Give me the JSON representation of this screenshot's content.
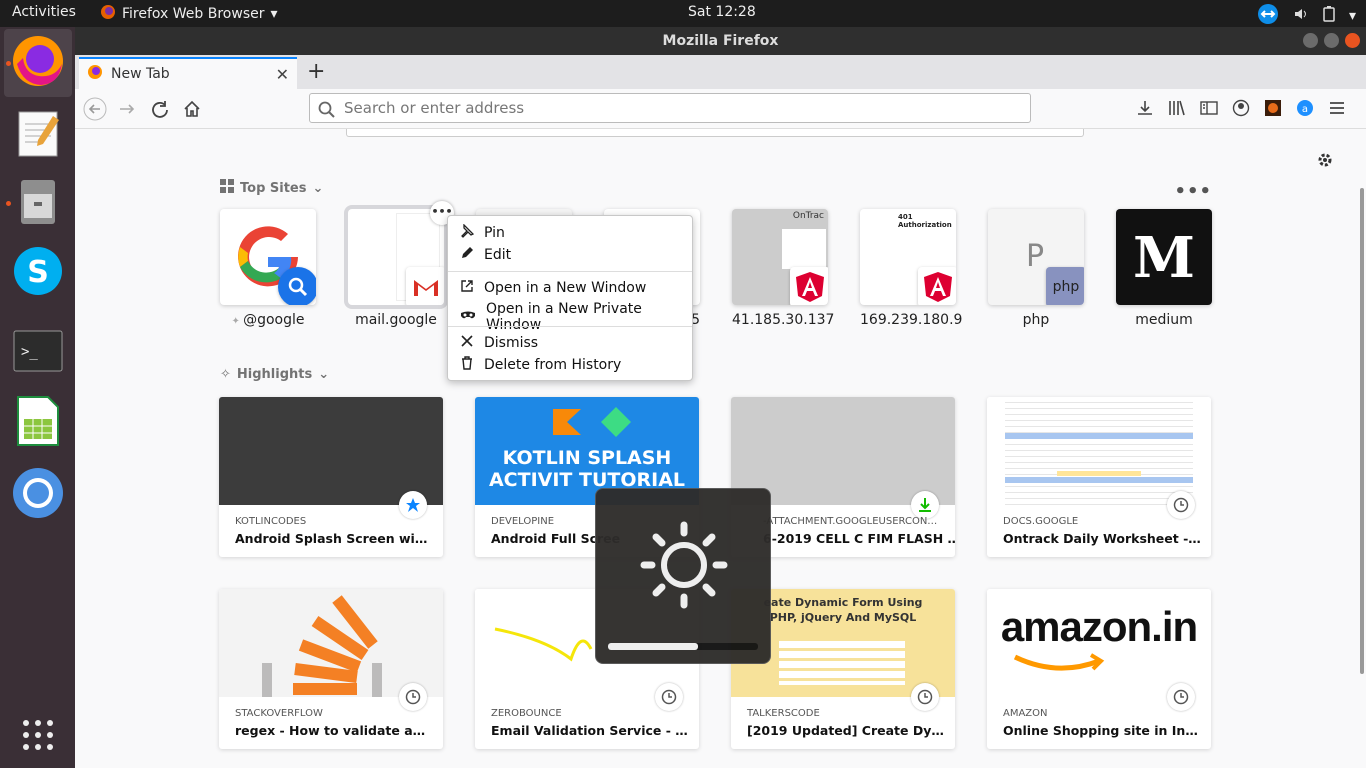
{
  "topbar": {
    "activities": "Activities",
    "app_menu": "Firefox Web Browser",
    "clock": "Sat 12:28"
  },
  "window": {
    "title": "Mozilla Firefox"
  },
  "tab": {
    "label": "New Tab"
  },
  "urlbar": {
    "placeholder": "Search or enter address"
  },
  "sections": {
    "top_sites": "Top Sites",
    "highlights": "Highlights"
  },
  "top_sites": [
    {
      "label": "@google"
    },
    {
      "label": "mail.google"
    },
    {
      "label": "5"
    },
    {
      "label": "41.185.30.137",
      "thumb_text": "OnTrac"
    },
    {
      "label": "169.239.180.9",
      "thumb_text": "401 Authorization"
    },
    {
      "label": "php",
      "thumb_text": "P"
    },
    {
      "label": "medium",
      "thumb_text": "M"
    }
  ],
  "context_menu": {
    "pin": "Pin",
    "edit": "Edit",
    "open_new_window": "Open in a New Window",
    "open_private_window": "Open in a New Private Window",
    "dismiss": "Dismiss",
    "delete_history": "Delete from History"
  },
  "highlights": [
    {
      "source": "KOTLINCODES",
      "title": "Android Splash Screen with Kot…"
    },
    {
      "source": "DEVELOPINE",
      "title": "Android Full Scree",
      "image_text": "KOTLIN SPLASH ACTIVIT TUTORIAL"
    },
    {
      "source": "-ATTACHMENT.GOOGLEUSERCON…",
      "title": "6-2019 CELL C FIM FLASH …"
    },
    {
      "source": "DOCS.GOOGLE",
      "title": "Ontrack Daily Worksheet - Goo…"
    },
    {
      "source": "STACKOVERFLOW",
      "title": "regex - How to validate an emai…"
    },
    {
      "source": "ZEROBOUNCE",
      "title": "Email Validation Service - Email…"
    },
    {
      "source": "TALKERSCODE",
      "title": "[2019 Updated] Create Dynami…",
      "image_text": "eate Dynamic Form Using PHP, jQuery And MySQL"
    },
    {
      "source": "AMAZON",
      "title": "Online Shopping site in India: Sh…",
      "image_text": "amazon.in"
    }
  ],
  "osd": {
    "brightness_level": 0.6
  },
  "colors": {
    "accent": "#0a84ff",
    "ubuntu_orange": "#e95420",
    "dock": "#3a2f36"
  }
}
